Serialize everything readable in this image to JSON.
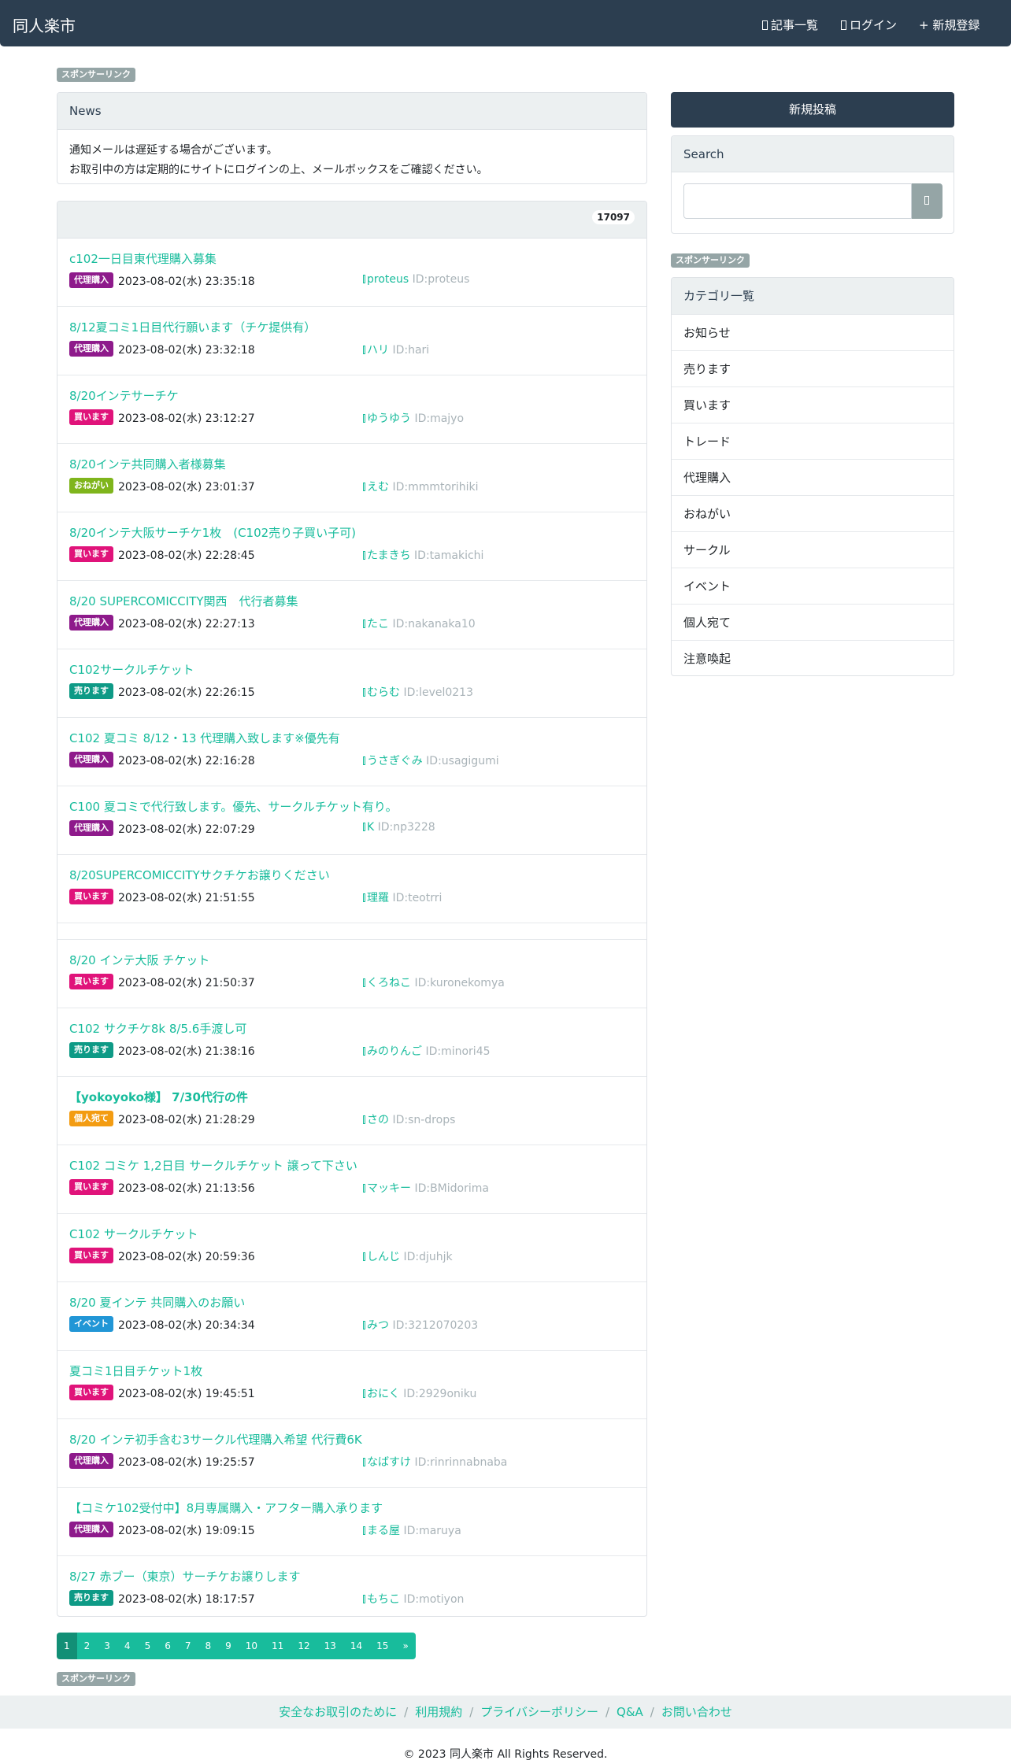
{
  "nav": {
    "brand": "同人楽市",
    "links": [
      "記事一覧",
      "ログイン",
      "+ 新規登録"
    ]
  },
  "sponsor_label": "スポンサーリンク",
  "news": {
    "header": "News",
    "lines": [
      "通知メールは遅延する場合がございます。",
      "お取引中の方は定期的にサイトにログインの上、メールボックスをご確認ください。"
    ]
  },
  "list": {
    "count": "17097",
    "posts": [
      {
        "title": "c102一日目東代理購入募集",
        "tag": "代理購入",
        "tag_color": "#8e1a8b",
        "date": "2023-08-02(水) 23:35:18",
        "user": "proteus",
        "uid": "ID:proteus"
      },
      {
        "title": "8/12夏コミ1日目代行願います（チケ提供有）",
        "tag": "代理購入",
        "tag_color": "#8e1a8b",
        "date": "2023-08-02(水) 23:32:18",
        "user": "ハリ",
        "uid": "ID:hari"
      },
      {
        "title": "8/20インテサーチケ",
        "tag": "買います",
        "tag_color": "#e0137a",
        "date": "2023-08-02(水) 23:12:27",
        "user": "ゆうゆう",
        "uid": "ID:majyo"
      },
      {
        "title": "8/20インテ共同購入者様募集",
        "tag": "おねがい",
        "tag_color": "#7fb51c",
        "date": "2023-08-02(水) 23:01:37",
        "user": "えむ",
        "uid": "ID:mmmtorihiki"
      },
      {
        "title": "8/20インテ大阪サーチケ1枚　(C102売り子買い子可)",
        "tag": "買います",
        "tag_color": "#e0137a",
        "date": "2023-08-02(水) 22:28:45",
        "user": "たまきち",
        "uid": "ID:tamakichi"
      },
      {
        "title": "8/20 SUPERCOMICCITY関西　代行者募集",
        "tag": "代理購入",
        "tag_color": "#8e1a8b",
        "date": "2023-08-02(水) 22:27:13",
        "user": "たこ",
        "uid": "ID:nakanaka10"
      },
      {
        "title": "C102サークルチケット",
        "tag": "売ります",
        "tag_color": "#0e9a86",
        "date": "2023-08-02(水) 22:26:15",
        "user": "むらむ",
        "uid": "ID:level0213"
      },
      {
        "title": "C102 夏コミ 8/12・13 代理購入致します※優先有",
        "tag": "代理購入",
        "tag_color": "#8e1a8b",
        "date": "2023-08-02(水) 22:16:28",
        "user": "うさぎぐみ",
        "uid": "ID:usagigumi"
      },
      {
        "title": "C100 夏コミで代行致します。優先、サークルチケット有り。",
        "tag": "代理購入",
        "tag_color": "#8e1a8b",
        "date": "2023-08-02(水) 22:07:29",
        "user": "K",
        "uid": "ID:np3228"
      },
      {
        "title": "8/20SUPERCOMICCITYサクチケお譲りください",
        "tag": "買います",
        "tag_color": "#e0137a",
        "date": "2023-08-02(水) 21:51:55",
        "user": "理羅",
        "uid": "ID:teotrri"
      },
      {
        "title": "8/20 インテ大阪 チケット",
        "tag": "買います",
        "tag_color": "#e0137a",
        "date": "2023-08-02(水) 21:50:37",
        "user": "くろねこ",
        "uid": "ID:kuronekomya"
      },
      {
        "title": "C102 サクチケ8k 8/5.6手渡し可",
        "tag": "売ります",
        "tag_color": "#0e9a86",
        "date": "2023-08-02(水) 21:38:16",
        "user": "みのりんご",
        "uid": "ID:minori45"
      },
      {
        "title": "【yokoyoko様】 7/30代行の件",
        "tag": "個人宛て",
        "tag_color": "#f39c12",
        "date": "2023-08-02(水) 21:28:29",
        "user": "さの",
        "uid": "ID:sn-drops"
      },
      {
        "title": "C102 コミケ 1,2日目 サークルチケット 譲って下さい",
        "tag": "買います",
        "tag_color": "#e0137a",
        "date": "2023-08-02(水) 21:13:56",
        "user": "マッキー",
        "uid": "ID:BMidorima"
      },
      {
        "title": "C102 サークルチケット",
        "tag": "買います",
        "tag_color": "#e0137a",
        "date": "2023-08-02(水) 20:59:36",
        "user": "しんじ",
        "uid": "ID:djuhjk"
      },
      {
        "title": "8/20 夏インテ 共同購入のお願い",
        "tag": "イベント",
        "tag_color": "#2196d6",
        "date": "2023-08-02(水) 20:34:34",
        "user": "みつ",
        "uid": "ID:3212070203"
      },
      {
        "title": "夏コミ1日目チケット1枚",
        "tag": "買います",
        "tag_color": "#e0137a",
        "date": "2023-08-02(水) 19:45:51",
        "user": "おにく",
        "uid": "ID:2929oniku"
      },
      {
        "title": "8/20 インテ初手含む3サークル代理購入希望 代行費6K",
        "tag": "代理購入",
        "tag_color": "#8e1a8b",
        "date": "2023-08-02(水) 19:25:57",
        "user": "なばすけ",
        "uid": "ID:rinrinnabnaba"
      },
      {
        "title": "【コミケ102受付中】8月専属購入・アフター購入承ります",
        "tag": "代理購入",
        "tag_color": "#8e1a8b",
        "date": "2023-08-02(水) 19:09:15",
        "user": "まる屋",
        "uid": "ID:maruya"
      },
      {
        "title": "8/27 赤ブー（東京）サーチケお譲りします",
        "tag": "売ります",
        "tag_color": "#0e9a86",
        "date": "2023-08-02(水) 18:17:57",
        "user": "もちこ",
        "uid": "ID:motiyon"
      }
    ]
  },
  "pagination": [
    "1",
    "2",
    "3",
    "4",
    "5",
    "6",
    "7",
    "8",
    "9",
    "10",
    "11",
    "12",
    "13",
    "14",
    "15",
    "»"
  ],
  "sidebar": {
    "new_post": "新規投稿",
    "search_header": "Search",
    "categories_header": "カテゴリ一覧",
    "categories": [
      "お知らせ",
      "売ります",
      "買います",
      "トレード",
      "代理購入",
      "おねがい",
      "サークル",
      "イベント",
      "個人宛て",
      "注意喚起"
    ]
  },
  "footer": {
    "links": [
      "安全なお取引のために",
      "利用規約",
      "プライバシーポリシー",
      "Q&A",
      "お問い合わせ"
    ],
    "copyright": "© 2023 同人楽市 All Rights Reserved."
  }
}
